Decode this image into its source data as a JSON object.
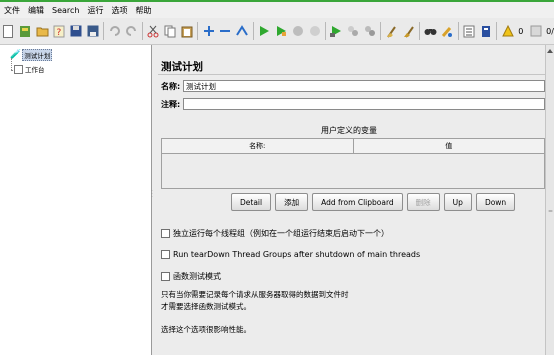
{
  "menu": [
    "文件",
    "编辑",
    "Search",
    "运行",
    "选项",
    "帮助"
  ],
  "toolbar": {
    "icons": [
      "new-icon",
      "templates-icon",
      "open-icon",
      "help-icon",
      "save-icon",
      "save-as-icon",
      "undo-icon",
      "redo-icon",
      "cut-icon",
      "copy-icon",
      "paste-icon",
      "expand-icon",
      "collapse-icon",
      "toggle-icon",
      "start-icon",
      "start-no-pause-icon",
      "stop-icon",
      "shutdown-icon",
      "remote-start-icon",
      "remote-stop-icon",
      "remote-exit-icon",
      "clear-icon",
      "clear-all-icon",
      "search-icon",
      "reset-search-icon",
      "function-helper-icon",
      "help-book-icon",
      "warning-icon"
    ],
    "warning_count": "0",
    "thread_count": "0/"
  },
  "tree": {
    "root_label": "测试计划",
    "child_label": "工作台"
  },
  "plan": {
    "title": "测试计划",
    "name_label": "名称:",
    "name_value": "测试计划",
    "comment_label": "注释:",
    "comment_value": ""
  },
  "variables": {
    "title": "用户定义的变量",
    "col_name": "名称:",
    "col_value": "值"
  },
  "buttons": {
    "detail": "Detail",
    "add": "添加",
    "add_clipboard": "Add from Clipboard",
    "delete": "删除",
    "up": "Up",
    "down": "Down"
  },
  "options": {
    "run_consecutive": "独立运行每个线程组（例如在一个组运行结束后启动下一个）",
    "run_teardown": "Run tearDown Thread Groups after shutdown of main threads",
    "functional_mode": "函数测试模式"
  },
  "notes": {
    "line1": "只有当你需要记录每个请求从服务器取得的数据到文件时",
    "line2": "才需要选择函数测试模式。",
    "line3": "选择这个选项很影响性能。"
  }
}
